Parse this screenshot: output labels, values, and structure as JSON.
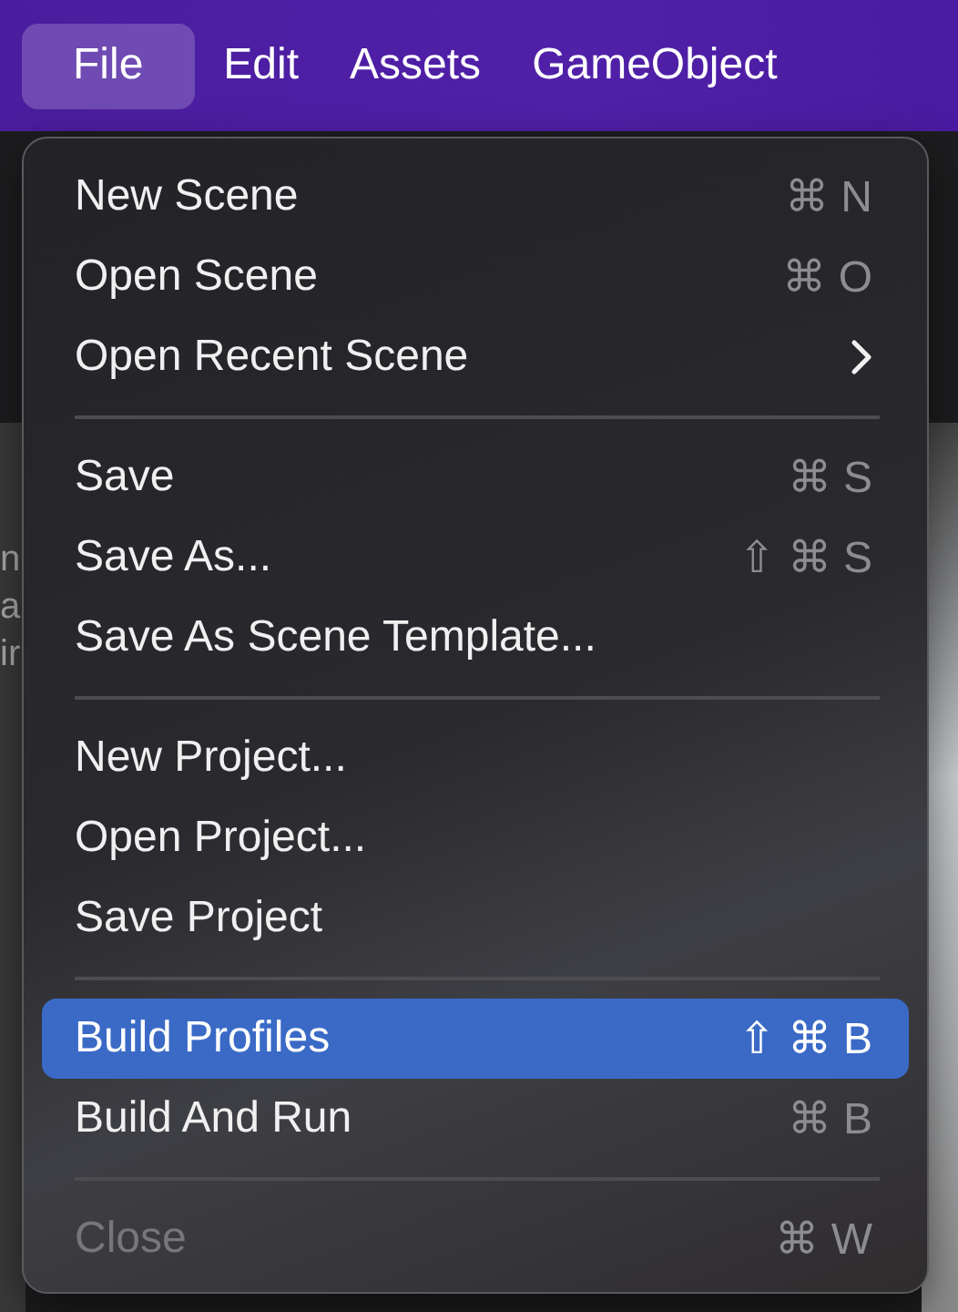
{
  "menu_bar": [
    {
      "label": "File",
      "selected": true
    },
    {
      "label": "Edit",
      "selected": false
    },
    {
      "label": "Assets",
      "selected": false
    },
    {
      "label": "GameObject",
      "selected": false
    }
  ],
  "background_fragments": [
    "n",
    "a",
    "ir"
  ],
  "menu": [
    {
      "kind": "item",
      "label": "New Scene",
      "shortcut": "⌘ N",
      "selected": false,
      "disabled": false
    },
    {
      "kind": "item",
      "label": "Open Scene",
      "shortcut": "⌘ O",
      "selected": false,
      "disabled": false
    },
    {
      "kind": "submenu",
      "label": "Open Recent Scene",
      "selected": false,
      "disabled": false
    },
    {
      "kind": "separator"
    },
    {
      "kind": "item",
      "label": "Save",
      "shortcut": "⌘ S",
      "selected": false,
      "disabled": false
    },
    {
      "kind": "item",
      "label": "Save As...",
      "shortcut": "⇧ ⌘ S",
      "selected": false,
      "disabled": false
    },
    {
      "kind": "item",
      "label": "Save As Scene Template...",
      "selected": false,
      "disabled": false
    },
    {
      "kind": "separator"
    },
    {
      "kind": "item",
      "label": "New Project...",
      "selected": false,
      "disabled": false
    },
    {
      "kind": "item",
      "label": "Open Project...",
      "selected": false,
      "disabled": false
    },
    {
      "kind": "item",
      "label": "Save Project",
      "selected": false,
      "disabled": false
    },
    {
      "kind": "separator"
    },
    {
      "kind": "item",
      "label": "Build Profiles",
      "shortcut": "⇧ ⌘ B",
      "selected": true,
      "disabled": false
    },
    {
      "kind": "item",
      "label": "Build And Run",
      "shortcut": "⌘ B",
      "selected": false,
      "disabled": false
    },
    {
      "kind": "separator"
    },
    {
      "kind": "item",
      "label": "Close",
      "shortcut": "⌘ W",
      "selected": false,
      "disabled": true
    }
  ]
}
